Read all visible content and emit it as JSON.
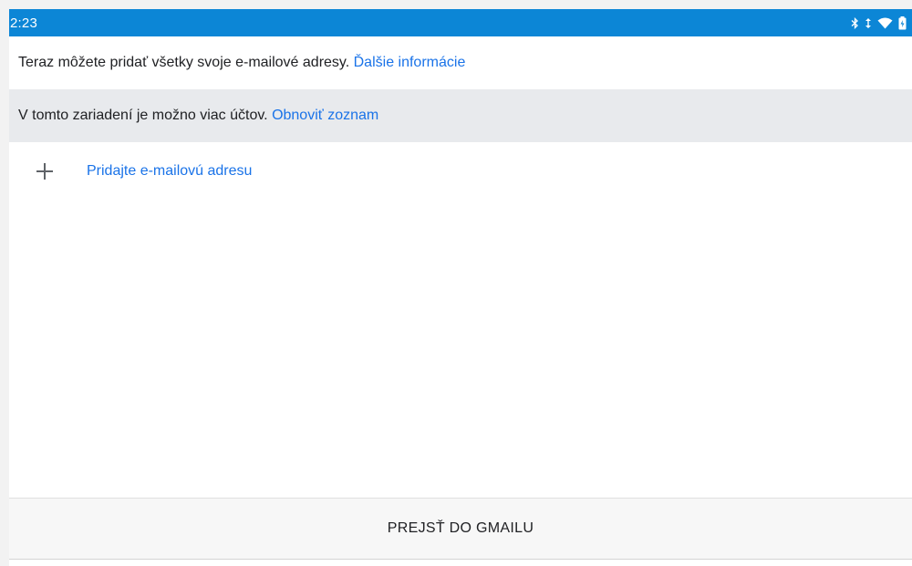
{
  "status_bar": {
    "time": "2:23",
    "color": "#0c86d6",
    "icons": [
      "bluetooth-icon",
      "data-arrows-icon",
      "wifi-icon",
      "battery-charging-icon"
    ]
  },
  "info": {
    "text": "Teraz môžete pridať všetky svoje e-mailové adresy. ",
    "link": "Ďalšie informácie"
  },
  "accounts_notice": {
    "text": "V tomto zariadení je možno viac účtov. ",
    "link": "Obnoviť zoznam"
  },
  "add_email": {
    "icon": "plus-icon",
    "label": "Pridajte e-mailovú adresu"
  },
  "footer": {
    "button_label": "PREJSŤ DO GMAILU"
  },
  "colors": {
    "accent_link": "#1a73e8",
    "notice_background": "#e8eaed"
  }
}
